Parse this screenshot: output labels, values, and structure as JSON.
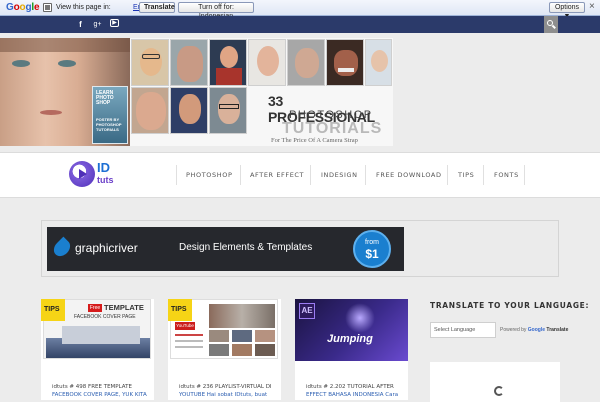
{
  "translate_bar": {
    "brand": "Google",
    "message": "View this page in:",
    "language": "English",
    "translate_label": "Translate",
    "turn_off_label": "Turn off for: Indonesian",
    "options_label": "Options ▼",
    "close_label": "×"
  },
  "social": {
    "facebook": "f",
    "googleplus": "g+",
    "youtube": "▶"
  },
  "banner": {
    "headline": "33 PROFESSIONAL",
    "line2": "PHOTOSHOP",
    "line3": "TUTORIALS",
    "line4": "For The Price Of A Camera Strap",
    "book_line1": "LEARN",
    "book_line2": "PHOTO",
    "book_line3": "SHOP",
    "book_line4": "POSTER BY",
    "book_line5": "PHOTOSHOP",
    "book_line6": "TUTORIALS"
  },
  "logo": {
    "part1": "ID",
    "part2": "tuts"
  },
  "nav": {
    "items": [
      "PHOTOSHOP",
      "AFTER EFFECT",
      "INDESIGN",
      "FREE DOWNLOAD",
      "TIPS",
      "FONTS"
    ]
  },
  "ad": {
    "brand": "graphicriver",
    "tagline": "Design Elements & Templates",
    "badge_top": "from",
    "badge_price": "$1"
  },
  "cards": [
    {
      "tag": "TIPS",
      "thumb_badge": "Free",
      "thumb_title": "TEMPLATE",
      "thumb_subtitle": "FACEBOOK COVER PAGE",
      "text_prefix": "idtuts # 498 FREE TEMPLATE",
      "text_rest": "FACEBOOK COVER PAGE, YUK KITA"
    },
    {
      "tag": "TIPS",
      "thumb_title": "YouTube",
      "text_prefix": "idtuts # 236 PLAYLIST-VIRTUAL DI",
      "text_rest": "YOUTUBE Hai sobat IDtuts, buat"
    },
    {
      "thumb_title": "AE",
      "thumb_caption": "Jumping",
      "text_prefix": "idtuts # 2.202 TUTORIAL AFTER",
      "text_rest": "EFFECT BAHASA INDONESIA Cara"
    }
  ],
  "sidebar": {
    "title": "TRANSLATE TO YOUR LANGUAGE:",
    "select_placeholder": "Select Language",
    "powered_prefix": "Powered by",
    "powered_google": "Google",
    "powered_translate": "Translate"
  },
  "colors": {
    "translate_bar": "#dfe7f5",
    "social_bar": "#2b3a6a",
    "ad_dark": "#26282d",
    "ad_blue": "#1a7fcf",
    "logo_blue": "#1c6fd4",
    "logo_purple": "#6a3fc8",
    "tips_yellow": "#f6d416"
  }
}
